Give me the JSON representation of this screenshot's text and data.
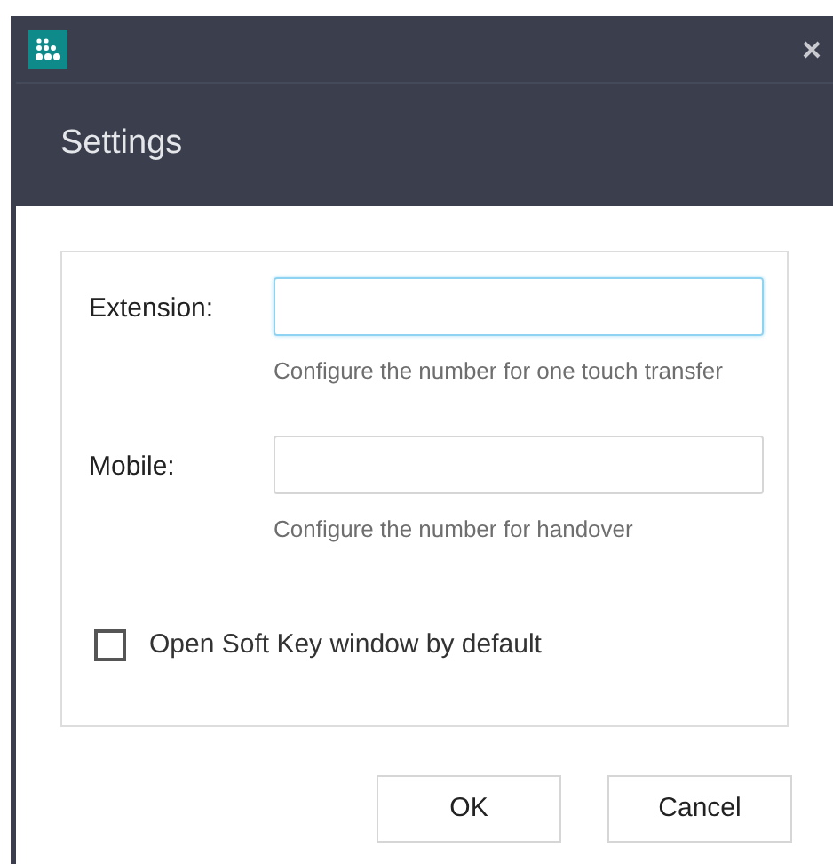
{
  "window": {
    "title": "Settings"
  },
  "fields": [
    {
      "label": "Extension:",
      "focused": true,
      "hint": "Configure the number for one touch transfer"
    },
    {
      "label": "Mobile:",
      "focused": false,
      "hint": "Configure the number for handover"
    }
  ],
  "checkbox": {
    "label": "Open Soft Key window by default",
    "checked": false
  },
  "buttons": [
    "OK",
    "Cancel"
  ]
}
